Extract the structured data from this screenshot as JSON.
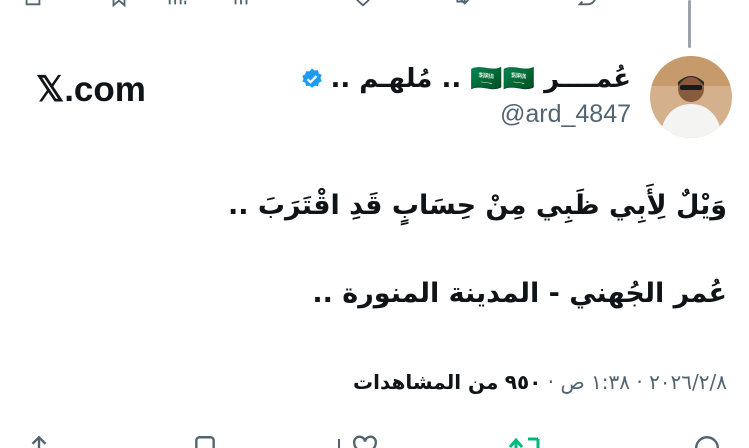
{
  "top_actions": {
    "icons": [
      "share-icon",
      "bookmark-icon",
      "views-icon",
      "like-icon",
      "repost-icon",
      "reply-icon"
    ]
  },
  "author": {
    "display_name": "عُمــــر 🇸🇦🇸🇦 .. مُلهـم ..",
    "handle": "@ard_4847",
    "verified": true,
    "verified_color": "#1d9bf0"
  },
  "brand": {
    "watermark": "𝕏.com"
  },
  "tweet": {
    "lines": [
      "وَيْلٌ لِأَبِي ظَبِي مِنْ حِسَابٍ قَدِ اقْتَرَبَ ..",
      "عُمر الجُهني - المدينة المنورة .."
    ]
  },
  "meta": {
    "date": "٢٠٢٦/٢/٨",
    "time": "١:٣٨ ص",
    "separator": "·",
    "views_count": "٩٥٠",
    "views_label": "من المشاهدات"
  },
  "bottom_actions": {
    "icons": [
      "reply-icon",
      "repost-icon",
      "like-icon",
      "bookmark-icon",
      "share-icon"
    ],
    "repost_color": "#00ba7c"
  }
}
